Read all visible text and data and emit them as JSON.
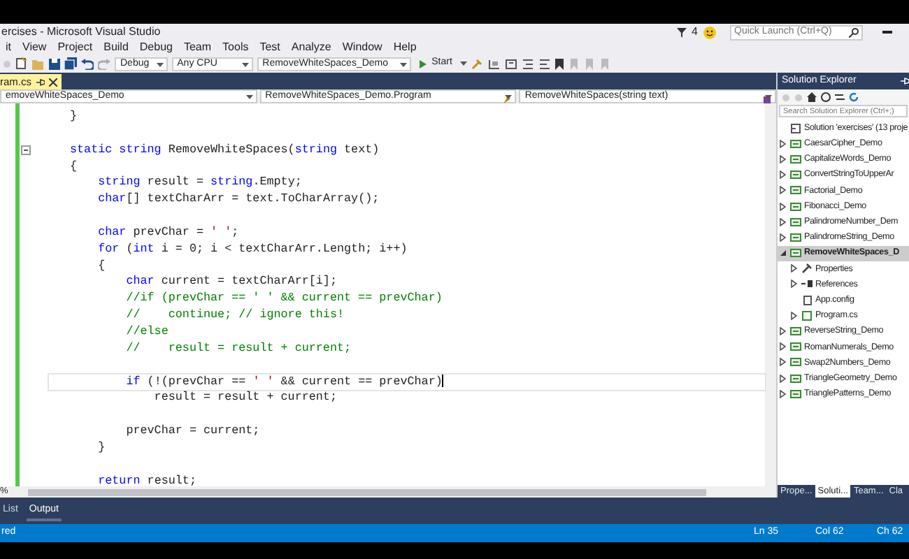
{
  "window": {
    "title": "ercises - Microsoft Visual Studio",
    "notification_count": "4",
    "quick_launch": {
      "placeholder": "Quick Launch (Ctrl+Q)"
    }
  },
  "menu": [
    "it",
    "View",
    "Project",
    "Build",
    "Debug",
    "Team",
    "Tools",
    "Test",
    "Analyze",
    "Window",
    "Help"
  ],
  "toolbar": {
    "configuration": "Debug",
    "platform": "Any CPU",
    "startup_project": "RemoveWhiteSpaces_Demo",
    "start_button": "Start"
  },
  "document_tab": {
    "label": "ram.cs",
    "selected": true
  },
  "navigation_bar": [
    "emoveWhiteSpaces_Demo",
    "RemoveWhiteSpaces_Demo.Program",
    "RemoveWhiteSpaces(string text)"
  ],
  "code_lines": [
    {
      "segments": [
        {
          "kind": "plain",
          "text": "}"
        }
      ]
    },
    {
      "blank_before": true,
      "fold": true,
      "segments": [
        {
          "kind": "keyword",
          "text": "static"
        },
        {
          "kind": "keyword",
          "text": " string"
        },
        {
          "kind": "plain",
          "text": " RemoveWhiteSpaces("
        },
        {
          "kind": "keyword",
          "text": "string"
        },
        {
          "kind": "plain",
          "text": " text)"
        }
      ]
    },
    {
      "segments": [
        {
          "kind": "plain",
          "text": "{"
        }
      ]
    },
    {
      "segments": [
        {
          "kind": "keyword",
          "text": "    string"
        },
        {
          "kind": "plain",
          "text": " result = "
        },
        {
          "kind": "keyword",
          "text": "string"
        },
        {
          "kind": "plain",
          "text": ".Empty;"
        }
      ]
    },
    {
      "segments": [
        {
          "kind": "keyword",
          "text": "    char"
        },
        {
          "kind": "plain",
          "text": "[] textCharArr = text.ToCharArray();"
        }
      ]
    },
    {
      "blank_before": true,
      "segments": [
        {
          "kind": "keyword",
          "text": "    char"
        },
        {
          "kind": "plain",
          "text": " prevChar = "
        },
        {
          "kind": "string",
          "text": "' '"
        },
        {
          "kind": "plain",
          "text": ";"
        }
      ]
    },
    {
      "segments": [
        {
          "kind": "keyword",
          "text": "    for"
        },
        {
          "kind": "plain",
          "text": " ("
        },
        {
          "kind": "keyword",
          "text": "int"
        },
        {
          "kind": "plain",
          "text": " i = 0; i < textCharArr.Length; i++)"
        }
      ]
    },
    {
      "segments": [
        {
          "kind": "plain",
          "text": "    {"
        }
      ]
    },
    {
      "segments": [
        {
          "kind": "keyword",
          "text": "        char"
        },
        {
          "kind": "plain",
          "text": " current = textCharArr[i];"
        }
      ]
    },
    {
      "segments": [
        {
          "kind": "comment",
          "text": "        //if (prevChar == ' ' && current == prevChar)"
        }
      ]
    },
    {
      "segments": [
        {
          "kind": "comment",
          "text": "        //    continue; // ignore this!"
        }
      ]
    },
    {
      "segments": [
        {
          "kind": "comment",
          "text": "        //else"
        }
      ]
    },
    {
      "segments": [
        {
          "kind": "comment",
          "text": "        //    result = result + current;"
        }
      ]
    },
    {
      "blank_before": true,
      "current": true,
      "segments": [
        {
          "kind": "keyword",
          "text": "        if"
        },
        {
          "kind": "plain",
          "text": " (!(prevChar == "
        },
        {
          "kind": "string",
          "text": "' '"
        },
        {
          "kind": "plain",
          "text": " && current == prevChar)"
        }
      ]
    },
    {
      "segments": [
        {
          "kind": "plain",
          "text": "            result = result + current;"
        }
      ]
    },
    {
      "blank_before": true,
      "segments": [
        {
          "kind": "plain",
          "text": "        prevChar = current;"
        }
      ]
    },
    {
      "segments": [
        {
          "kind": "plain",
          "text": "    }"
        }
      ]
    },
    {
      "blank_before": true,
      "segments": [
        {
          "kind": "keyword",
          "text": "    return"
        },
        {
          "kind": "plain",
          "text": " result;"
        }
      ]
    }
  ],
  "zoom_level": "%",
  "solution_explorer": {
    "title": "Solution Explorer",
    "search": {
      "placeholder": "Search Solution Explorer (Ctrl+;)"
    },
    "tree": [
      {
        "kind": "solution",
        "label": "Solution 'exercises' (13 proje",
        "selected": false
      },
      {
        "kind": "project",
        "label": "CaesarCipher_Demo",
        "expanded": false,
        "selected": false
      },
      {
        "kind": "project",
        "label": "CapitalizeWords_Demo",
        "expanded": false,
        "selected": false
      },
      {
        "kind": "project",
        "label": "ConvertStringToUpperAr",
        "expanded": false,
        "selected": false
      },
      {
        "kind": "project",
        "label": "Factorial_Demo",
        "expanded": false,
        "selected": false
      },
      {
        "kind": "project",
        "label": "Fibonacci_Demo",
        "expanded": false,
        "selected": false
      },
      {
        "kind": "project",
        "label": "PalindromeNumber_Dem",
        "expanded": false,
        "selected": false
      },
      {
        "kind": "project",
        "label": "PalindromeString_Demo",
        "expanded": false,
        "selected": false
      },
      {
        "kind": "project",
        "label": "RemoveWhiteSpaces_D",
        "expanded": true,
        "selected": true,
        "children": [
          {
            "kind": "properties",
            "label": "Properties",
            "expanded": false,
            "selected": false
          },
          {
            "kind": "references",
            "label": "References",
            "expanded": false,
            "selected": false
          },
          {
            "kind": "config",
            "label": "App.config",
            "selected": false
          },
          {
            "kind": "csfile",
            "label": "Program.cs",
            "expanded": false,
            "selected": false
          }
        ]
      },
      {
        "kind": "project",
        "label": "ReverseString_Demo",
        "expanded": false,
        "selected": false
      },
      {
        "kind": "project",
        "label": "RomanNumerals_Demo",
        "expanded": false,
        "selected": false
      },
      {
        "kind": "project",
        "label": "Swap2Numbers_Demo",
        "expanded": false,
        "selected": false
      },
      {
        "kind": "project",
        "label": "TriangleGeometry_Demo",
        "expanded": false,
        "selected": false
      },
      {
        "kind": "project",
        "label": "TrianglePatterns_Demo",
        "expanded": false,
        "selected": false
      }
    ],
    "tabs": [
      {
        "label": "Prope...",
        "selected": false
      },
      {
        "label": "Soluti...",
        "selected": true
      },
      {
        "label": "Team...",
        "selected": false
      },
      {
        "label": "Cla",
        "selected": false
      }
    ]
  },
  "bottom_tabs": [
    {
      "label": "List",
      "selected": false
    },
    {
      "label": "Output",
      "selected": true
    }
  ],
  "status_bar": {
    "message": "red",
    "line": "Ln 35",
    "column": "Col 62",
    "character": "Ch 62"
  }
}
